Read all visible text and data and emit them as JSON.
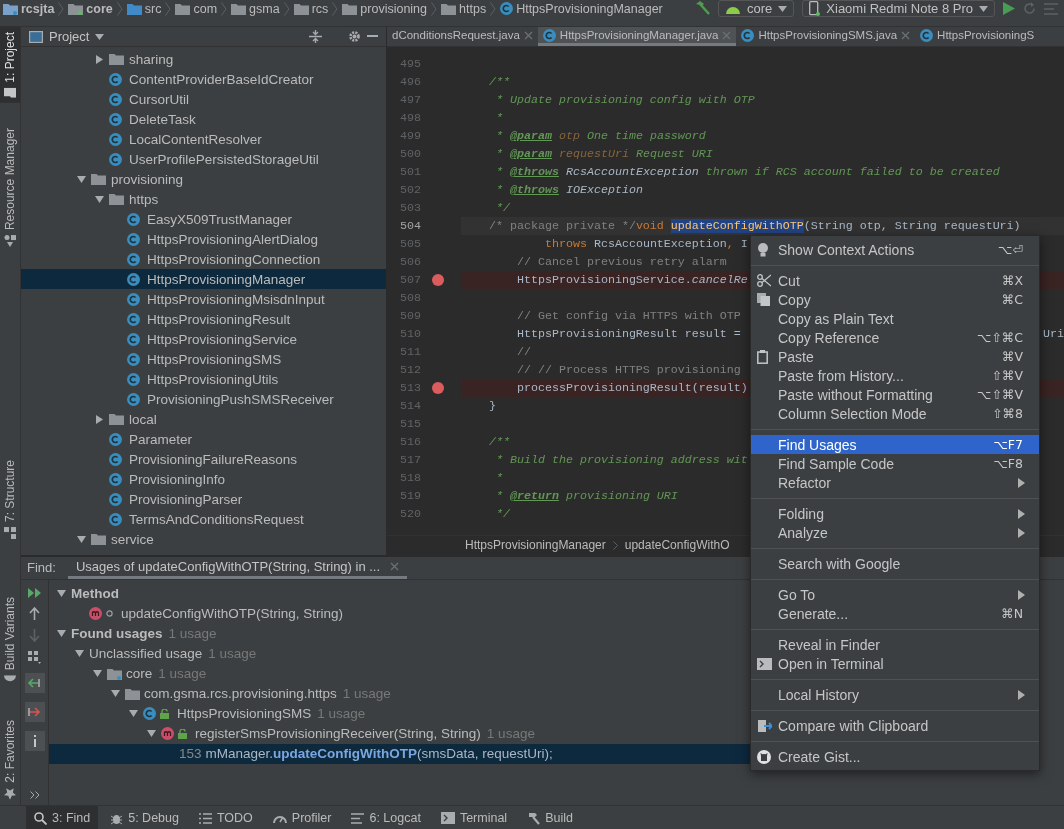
{
  "navbar": {
    "breadcrumbs": [
      {
        "label": "rcsjta",
        "kind": "project"
      },
      {
        "label": "core",
        "kind": "module"
      },
      {
        "label": "src",
        "kind": "source"
      },
      {
        "label": "com",
        "kind": "package"
      },
      {
        "label": "gsma",
        "kind": "package"
      },
      {
        "label": "rcs",
        "kind": "package"
      },
      {
        "label": "provisioning",
        "kind": "package"
      },
      {
        "label": "https",
        "kind": "package"
      },
      {
        "label": "HttpsProvisioningManager",
        "kind": "class"
      }
    ],
    "run_config": {
      "label": "core"
    },
    "device": {
      "label": "Xiaomi Redmi Note 8 Pro"
    }
  },
  "left_strip": {
    "top": [
      {
        "label": "1: Project",
        "selected": true
      },
      {
        "label": "Resource Manager",
        "selected": false
      },
      {
        "label": "7: Structure",
        "selected": false
      }
    ],
    "bottom": [
      {
        "label": "Build Variants",
        "selected": false
      },
      {
        "label": "2: Favorites",
        "selected": false
      }
    ]
  },
  "project": {
    "title": "Project",
    "tree": [
      {
        "children": [
          {
            "label": "sharing",
            "kind": "folder",
            "expanded": false,
            "selected": false
          },
          {
            "label": "ContentProviderBaseIdCreator",
            "kind": "class",
            "selected": false
          },
          {
            "label": "CursorUtil",
            "kind": "class",
            "selected": false
          },
          {
            "label": "DeleteTask",
            "kind": "class",
            "selected": false
          },
          {
            "label": "LocalContentResolver",
            "kind": "class",
            "selected": false
          },
          {
            "label": "UserProfilePersistedStorageUtil",
            "kind": "class",
            "selected": false
          }
        ]
      },
      {
        "label": "provisioning",
        "kind": "folder",
        "expanded": true,
        "selected": false,
        "children": [
          {
            "label": "https",
            "kind": "folder",
            "expanded": true,
            "selected": false,
            "children": [
              {
                "label": "EasyX509TrustManager",
                "kind": "class",
                "selected": false
              },
              {
                "label": "HttpsProvisioningAlertDialog",
                "kind": "class",
                "selected": false
              },
              {
                "label": "HttpsProvisioningConnection",
                "kind": "class",
                "selected": false
              },
              {
                "label": "HttpsProvisioningManager",
                "kind": "class",
                "selected": true
              },
              {
                "label": "HttpsProvisioningMsisdnInput",
                "kind": "class",
                "selected": false
              },
              {
                "label": "HttpsProvisioningResult",
                "kind": "class",
                "selected": false
              },
              {
                "label": "HttpsProvisioningService",
                "kind": "class",
                "selected": false
              },
              {
                "label": "HttpsProvisioningSMS",
                "kind": "class",
                "selected": false
              },
              {
                "label": "HttpsProvisioningUtils",
                "kind": "class",
                "selected": false
              },
              {
                "label": "ProvisioningPushSMSReceiver",
                "kind": "class",
                "selected": false
              }
            ]
          },
          {
            "label": "local",
            "kind": "folder",
            "expanded": false,
            "selected": false
          },
          {
            "label": "Parameter",
            "kind": "class",
            "selected": false
          },
          {
            "label": "ProvisioningFailureReasons",
            "kind": "class",
            "selected": false
          },
          {
            "label": "ProvisioningInfo",
            "kind": "class",
            "selected": false
          },
          {
            "label": "ProvisioningParser",
            "kind": "class",
            "selected": false
          },
          {
            "label": "TermsAndConditionsRequest",
            "kind": "class",
            "selected": false
          }
        ]
      },
      {
        "label": "service",
        "kind": "folder",
        "expanded": true,
        "selected": false
      }
    ]
  },
  "editor": {
    "tabs": [
      {
        "label": "dConditionsRequest.java",
        "selected": false
      },
      {
        "label": "HttpsProvisioningManager.java",
        "selected": true
      },
      {
        "label": "HttpsProvisioningSMS.java",
        "selected": false
      },
      {
        "label": "HttpsProvisioningS",
        "selected": false
      }
    ],
    "lines": [
      {
        "number": "495",
        "breakpoint": false,
        "current": false
      },
      {
        "number": "496",
        "breakpoint": false,
        "current": false,
        "segments": [
          {
            "kind": "doc",
            "text": "    /**"
          }
        ]
      },
      {
        "number": "497",
        "breakpoint": false,
        "current": false,
        "segments": [
          {
            "kind": "doc",
            "text": "     * Update provisioning config with OTP"
          }
        ]
      },
      {
        "number": "498",
        "breakpoint": false,
        "current": false,
        "segments": [
          {
            "kind": "doc",
            "text": "     *"
          }
        ]
      },
      {
        "number": "499",
        "breakpoint": false,
        "current": false,
        "segments": [
          {
            "kind": "doc",
            "text": "     * "
          },
          {
            "kind": "tag",
            "text": "@param"
          },
          {
            "kind": "param",
            "text": " otp"
          },
          {
            "kind": "doc",
            "text": " One time password"
          }
        ]
      },
      {
        "number": "500",
        "breakpoint": false,
        "current": false,
        "segments": [
          {
            "kind": "doc",
            "text": "     * "
          },
          {
            "kind": "tag",
            "text": "@param"
          },
          {
            "kind": "param",
            "text": " requestUri"
          },
          {
            "kind": "doc",
            "text": " Request URI"
          }
        ]
      },
      {
        "number": "501",
        "breakpoint": false,
        "current": false,
        "segments": [
          {
            "kind": "doc",
            "text": "     * "
          },
          {
            "kind": "tag",
            "text": "@throws"
          },
          {
            "kind": "docref",
            "text": " RcsAccountException"
          },
          {
            "kind": "doc",
            "text": " thrown if RCS account failed to be created"
          }
        ]
      },
      {
        "number": "502",
        "breakpoint": false,
        "current": false,
        "segments": [
          {
            "kind": "doc",
            "text": "     * "
          },
          {
            "kind": "tag",
            "text": "@throws"
          },
          {
            "kind": "docref",
            "text": " IOException"
          }
        ]
      },
      {
        "number": "503",
        "breakpoint": false,
        "current": false,
        "segments": [
          {
            "kind": "doc",
            "text": "     */"
          }
        ]
      },
      {
        "number": "504",
        "breakpoint": false,
        "current": true,
        "segments": [
          {
            "kind": "comment",
            "text": "    /* package private */"
          },
          {
            "kind": "keyword",
            "text": "void "
          },
          {
            "kind": "selection",
            "text": "updateConfigWithOTP"
          },
          {
            "kind": "plain",
            "text": "(String otp, String requestUri)"
          }
        ]
      },
      {
        "number": "505",
        "breakpoint": false,
        "current": false,
        "segments": [
          {
            "kind": "keyword",
            "text": "            throws"
          },
          {
            "kind": "plain",
            "text": " RcsAccountException"
          },
          {
            "kind": "keyword",
            "text": ","
          },
          {
            "kind": "plain",
            "text": " I"
          }
        ]
      },
      {
        "number": "506",
        "breakpoint": false,
        "current": false,
        "segments": [
          {
            "kind": "comment",
            "text": "        // Cancel previous retry alarm"
          }
        ]
      },
      {
        "number": "507",
        "breakpoint": true,
        "current": false,
        "segments": [
          {
            "kind": "plain",
            "text": "        HttpsProvisioningService."
          },
          {
            "kind": "italic",
            "text": "cancelRe"
          }
        ]
      },
      {
        "number": "508",
        "breakpoint": false,
        "current": false
      },
      {
        "number": "509",
        "breakpoint": false,
        "current": false,
        "segments": [
          {
            "kind": "comment",
            "text": "        // Get config via HTTPS with OTP"
          }
        ]
      },
      {
        "number": "510",
        "breakpoint": false,
        "current": false,
        "segments": [
          {
            "kind": "plain",
            "text": "        HttpsProvisioningResult result ="
          }
        ],
        "tail": "Uri"
      },
      {
        "number": "511",
        "breakpoint": false,
        "current": false,
        "segments": [
          {
            "kind": "comment",
            "text": "        //"
          }
        ]
      },
      {
        "number": "512",
        "breakpoint": false,
        "current": false,
        "segments": [
          {
            "kind": "comment",
            "text": "        // // Process HTTPS provisioning"
          }
        ]
      },
      {
        "number": "513",
        "breakpoint": true,
        "current": false,
        "segments": [
          {
            "kind": "plain",
            "text": "        processProvisioningResult(result)"
          }
        ]
      },
      {
        "number": "514",
        "breakpoint": false,
        "current": false,
        "segments": [
          {
            "kind": "plain",
            "text": "    }"
          }
        ]
      },
      {
        "number": "515",
        "breakpoint": false,
        "current": false
      },
      {
        "number": "516",
        "breakpoint": false,
        "current": false,
        "segments": [
          {
            "kind": "doc",
            "text": "    /**"
          }
        ]
      },
      {
        "number": "517",
        "breakpoint": false,
        "current": false,
        "segments": [
          {
            "kind": "doc",
            "text": "     * Build the provisioning address wit"
          }
        ]
      },
      {
        "number": "518",
        "breakpoint": false,
        "current": false,
        "segments": [
          {
            "kind": "doc",
            "text": "     *"
          }
        ]
      },
      {
        "number": "519",
        "breakpoint": false,
        "current": false,
        "segments": [
          {
            "kind": "doc",
            "text": "     * "
          },
          {
            "kind": "tag",
            "text": "@return"
          },
          {
            "kind": "doc",
            "text": " provisioning URI"
          }
        ]
      },
      {
        "number": "520",
        "breakpoint": false,
        "current": false,
        "segments": [
          {
            "kind": "doc",
            "text": "     */"
          }
        ]
      }
    ],
    "breadcrumbs": [
      "HttpsProvisioningManager",
      "updateConfigWithO"
    ]
  },
  "find": {
    "label": "Find:",
    "tabs": [
      {
        "label": "Usages of updateConfigWithOTP(String, String) in ...",
        "selected": true
      }
    ],
    "tree": [
      {
        "label": "Method",
        "kind": "group",
        "expanded": true,
        "selected": false,
        "children": [
          {
            "label": "updateConfigWithOTP(String, String)",
            "kind": "method_package",
            "selected": false
          }
        ]
      },
      {
        "label": "Found usages",
        "kind": "group",
        "count": "1 usage",
        "expanded": true,
        "selected": false,
        "children": [
          {
            "label": "Unclassified usage",
            "kind": "plain",
            "count": "1 usage",
            "expanded": true,
            "selected": false,
            "children": [
              {
                "label": "core",
                "kind": "module",
                "count": "1 usage",
                "expanded": true,
                "selected": false,
                "children": [
                  {
                    "label": "com.gsma.rcs.provisioning.https",
                    "kind": "package",
                    "count": "1 usage",
                    "expanded": true,
                    "selected": false,
                    "children": [
                      {
                        "label": "HttpsProvisioningSMS",
                        "kind": "class",
                        "count": "1 usage",
                        "expanded": true,
                        "selected": false,
                        "children": [
                          {
                            "label": "registerSmsProvisioningReceiver(String, String)",
                            "kind": "method",
                            "count": "1 usage",
                            "expanded": true,
                            "selected": false,
                            "children": [
                              {
                                "kind": "line",
                                "number": "153",
                                "label": "mManager.**updateConfigWithOTP**(smsData, requestUri);",
                                "selected": true
                              }
                            ]
                          }
                        ]
                      }
                    ]
                  }
                ]
              }
            ]
          }
        ]
      }
    ]
  },
  "context_menu": {
    "groups": [
      [
        {
          "label": "Show Context Actions",
          "shortcut": "⌥⏎",
          "submenu": false,
          "selected": false
        }
      ],
      [
        {
          "label": "Cut",
          "shortcut": "⌘X",
          "submenu": false,
          "selected": false
        },
        {
          "label": "Copy",
          "shortcut": "⌘C",
          "submenu": false,
          "selected": false
        },
        {
          "label": "Copy as Plain Text",
          "submenu": false,
          "selected": false
        },
        {
          "label": "Copy Reference",
          "shortcut": "⌥⇧⌘C",
          "submenu": false,
          "selected": false
        },
        {
          "label": "Paste",
          "shortcut": "⌘V",
          "submenu": false,
          "selected": false
        },
        {
          "label": "Paste from History...",
          "shortcut": "⇧⌘V",
          "submenu": false,
          "selected": false
        },
        {
          "label": "Paste without Formatting",
          "shortcut": "⌥⇧⌘V",
          "submenu": false,
          "selected": false
        },
        {
          "label": "Column Selection Mode",
          "shortcut": "⇧⌘8",
          "submenu": false,
          "selected": false
        }
      ],
      [
        {
          "label": "Find Usages",
          "shortcut": "⌥F7",
          "submenu": false,
          "selected": true
        },
        {
          "label": "Find Sample Code",
          "shortcut": "⌥F8",
          "submenu": false,
          "selected": false
        },
        {
          "label": "Refactor",
          "submenu": true,
          "selected": false
        }
      ],
      [
        {
          "label": "Folding",
          "submenu": true,
          "selected": false
        },
        {
          "label": "Analyze",
          "submenu": true,
          "selected": false
        }
      ],
      [
        {
          "label": "Search with Google",
          "submenu": false,
          "selected": false
        }
      ],
      [
        {
          "label": "Go To",
          "submenu": true,
          "selected": false
        },
        {
          "label": "Generate...",
          "shortcut": "⌘N",
          "submenu": false,
          "selected": false
        }
      ],
      [
        {
          "label": "Reveal in Finder",
          "submenu": false,
          "selected": false
        },
        {
          "label": "Open in Terminal",
          "submenu": false,
          "selected": false
        }
      ],
      [
        {
          "label": "Local History",
          "submenu": true,
          "selected": false
        }
      ],
      [
        {
          "label": "Compare with Clipboard",
          "submenu": false,
          "selected": false
        }
      ],
      [
        {
          "label": "Create Gist...",
          "submenu": false,
          "selected": false
        }
      ]
    ]
  },
  "tool_bar": [
    {
      "label": "3: Find",
      "selected": true
    },
    {
      "label": "5: Debug",
      "selected": false
    },
    {
      "label": "TODO",
      "selected": false
    },
    {
      "label": "Profiler",
      "selected": false
    },
    {
      "label": "6: Logcat",
      "selected": false
    },
    {
      "label": "Terminal",
      "selected": false
    },
    {
      "label": "Build",
      "selected": false
    }
  ]
}
